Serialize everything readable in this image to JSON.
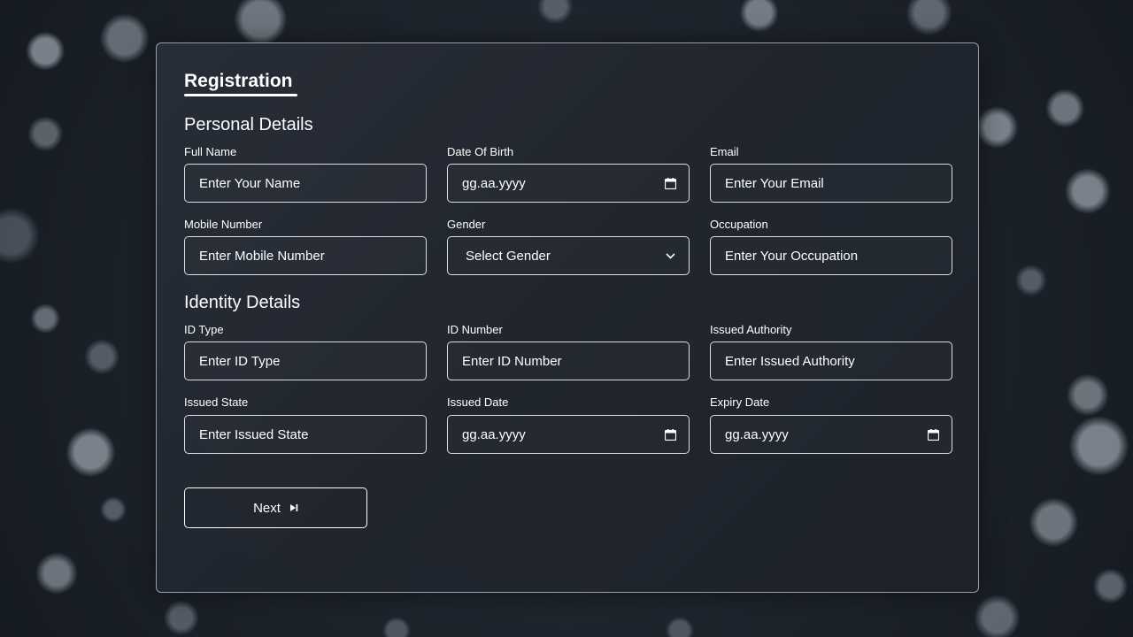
{
  "form": {
    "title": "Registration",
    "next_label": "Next",
    "next_icon": "skip-forward-icon"
  },
  "personal": {
    "title": "Personal Details",
    "full_name": {
      "label": "Full Name",
      "placeholder": "Enter Your Name"
    },
    "dob": {
      "label": "Date Of Birth",
      "placeholder": "gg.aa.yyyy"
    },
    "email": {
      "label": "Email",
      "placeholder": "Enter Your Email"
    },
    "mobile": {
      "label": "Mobile Number",
      "placeholder": "Enter Mobile Number"
    },
    "gender": {
      "label": "Gender",
      "selected": "Select Gender"
    },
    "occupation": {
      "label": "Occupation",
      "placeholder": "Enter Your Occupation"
    }
  },
  "identity": {
    "title": "Identity Details",
    "id_type": {
      "label": "ID Type",
      "placeholder": "Enter ID Type"
    },
    "id_number": {
      "label": "ID Number",
      "placeholder": "Enter ID Number"
    },
    "issued_authority": {
      "label": "Issued Authority",
      "placeholder": "Enter Issued Authority"
    },
    "issued_state": {
      "label": "Issued State",
      "placeholder": "Enter Issued State"
    },
    "issued_date": {
      "label": "Issued Date",
      "placeholder": "gg.aa.yyyy"
    },
    "expiry_date": {
      "label": "Expiry Date",
      "placeholder": "gg.aa.yyyy"
    }
  },
  "colors": {
    "card_border": "#ffffff",
    "text": "#ffffff",
    "background": "#1f252e"
  }
}
